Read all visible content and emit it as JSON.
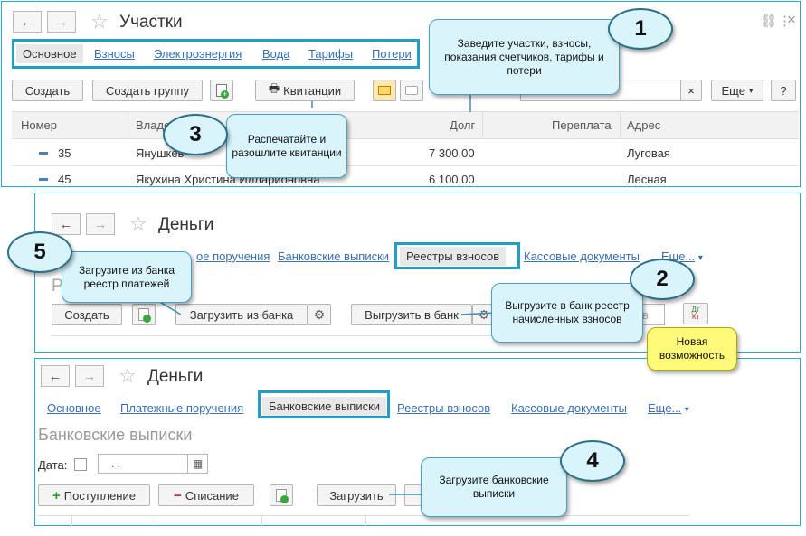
{
  "p1": {
    "title": "Участки",
    "tabs": [
      "Основное",
      "Взносы",
      "Электроэнергия",
      "Вода",
      "Тарифы",
      "Потери"
    ],
    "buttons": {
      "create": "Создать",
      "create_group": "Создать группу",
      "receipts": "Квитанции",
      "more": "Еще",
      "help": "?",
      "clear": "×"
    },
    "columns": [
      "Номер",
      "Владе",
      "Долг",
      "Переплата",
      "Адрес"
    ],
    "rows": [
      {
        "num": "35",
        "owner": "Янушкев",
        "debt": "7 300,00",
        "overpay": "",
        "address": "Луговая"
      },
      {
        "num": "45",
        "owner": "Якухина Христина Илларионовна",
        "debt": "6 100,00",
        "overpay": "",
        "address": "Лесная"
      }
    ]
  },
  "p2": {
    "title": "Деньги",
    "tabs": [
      "ое поручения",
      "Банковские выписки",
      "Реестры взносов",
      "Кассовые документы",
      "Еще..."
    ],
    "buttons": {
      "create": "Создать",
      "load_bank": "Загрузить из банка",
      "upload_bank": "Выгрузить в банк",
      "trunc": "в"
    },
    "dtkt_top": "Дт",
    "dtkt_bottom": "Кт"
  },
  "p3": {
    "title": "Деньги",
    "tabs": [
      "Основное",
      "Платежные поручения",
      "Банковские выписки",
      "Реестры взносов",
      "Кассовые документы",
      "Еще..."
    ],
    "heading": "Банковские выписки",
    "date_label": "Дата:",
    "date_value": ". .",
    "buttons": {
      "income": "Поступление",
      "outcome": "Списание",
      "load": "Загрузить"
    }
  },
  "callouts": {
    "c1": "Заведите участки, взносы, показания счетчиков, тарифы и потери",
    "c2": "Выгрузите в банк реестр начисленных взносов",
    "c3": "Распечатайте и разошлите квитанции",
    "c4": "Загрузите банковские выписки",
    "c5": "Загрузите из банка реестр платежей",
    "new": "Новая возможность"
  },
  "numbers": {
    "n1": "1",
    "n2": "2",
    "n3": "3",
    "n4": "4",
    "n5": "5"
  },
  "icons": {
    "back": "←",
    "fwd": "→",
    "star": "☆",
    "link": "🔗",
    "more": "⋮",
    "close": "×",
    "chevron": "▾",
    "gear": "⚙",
    "plus": "+",
    "minus": "−",
    "calendar": "▦",
    "printer": "🖶"
  }
}
